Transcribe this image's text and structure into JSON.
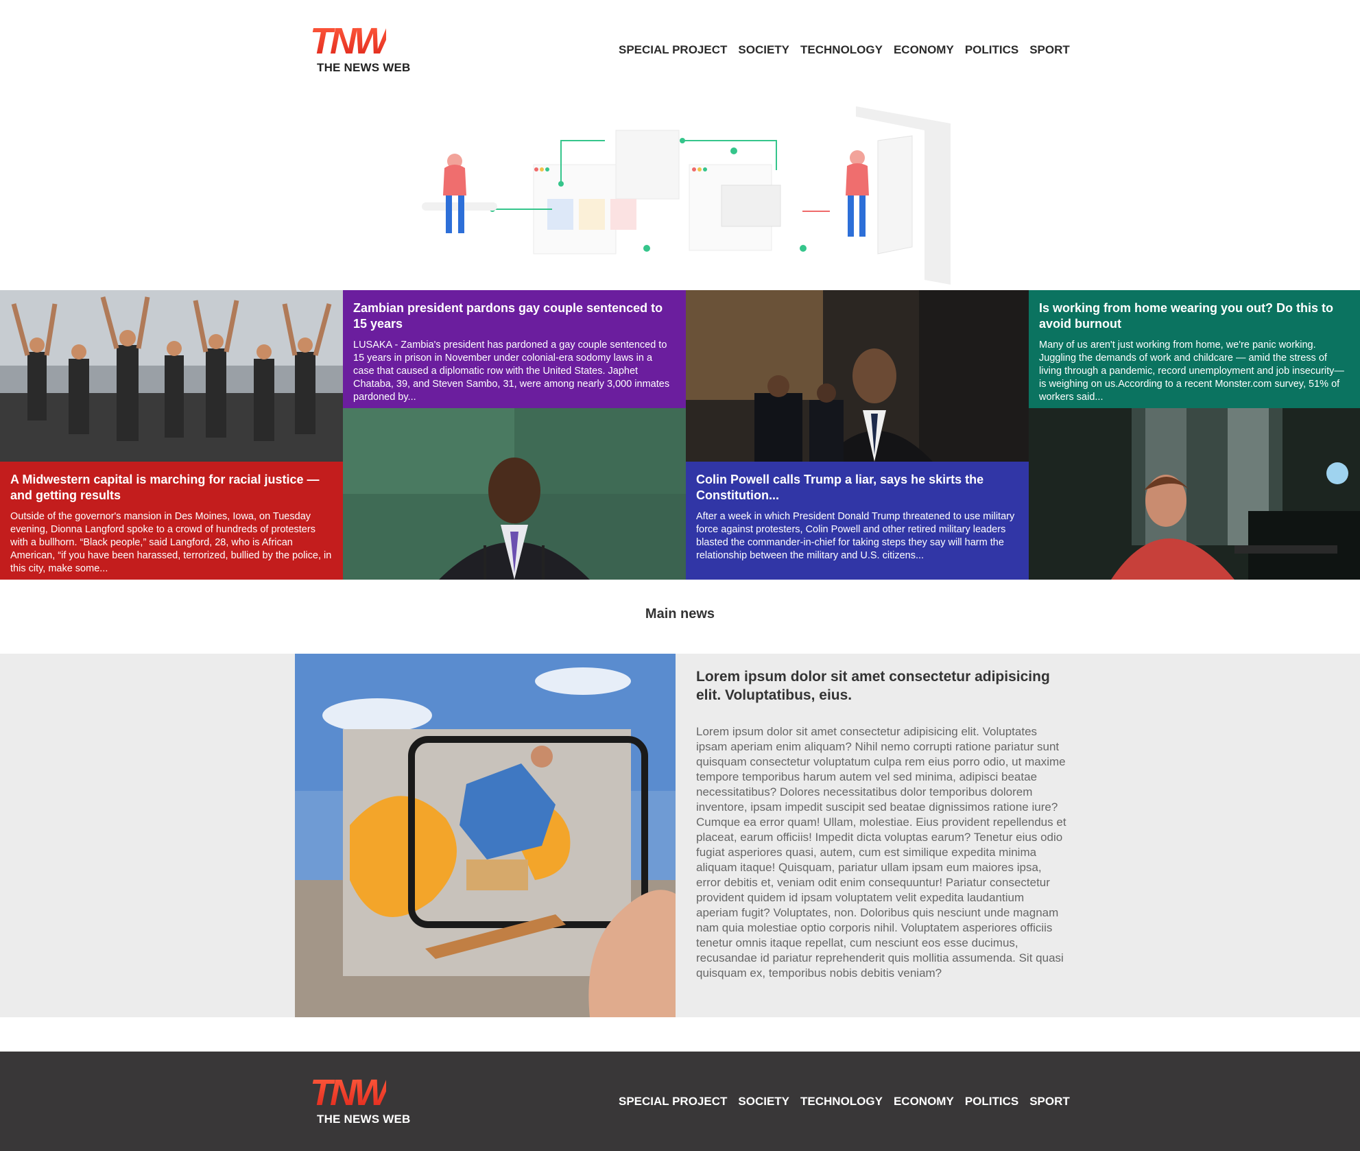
{
  "header": {
    "logo_mark": "TNW",
    "logo_sub": "THE NEWS WEB",
    "nav": [
      "SPECIAL PROJECT",
      "SOCIETY",
      "TECHNOLOGY",
      "ECONOMY",
      "POLITICS",
      "SPORT"
    ]
  },
  "articles": [
    {
      "title": "A Midwestern capital is marching for racial justice — and getting results",
      "excerpt": "Outside of the governor's mansion in Des Moines, Iowa, on Tuesday evening, Dionna Langford spoke to a crowd of hundreds of protesters with a bullhorn. “Black people,” said Langford, 28, who is African American, “if you have been harassed, terrorized, bullied by the police, in this city, make some...",
      "color": "#c31d1d"
    },
    {
      "title": "Zambian president pardons gay couple sentenced to 15 years",
      "excerpt": "LUSAKA - Zambia's president has pardoned a gay couple sentenced to 15 years in prison in November under colonial-era sodomy laws in a case that caused a diplomatic row with the United States. Japhet Chataba, 39, and Steven Sambo, 31, were among nearly 3,000 inmates pardoned by...",
      "color": "#6b1e9e"
    },
    {
      "title": "Colin Powell calls Trump a liar, says he skirts the Constitution...",
      "excerpt": "After a week in which President Donald Trump threatened to use military force against protesters, Colin Powell and other retired military leaders blasted the commander-in-chief for taking steps they say will harm the relationship between the military and U.S. citizens...",
      "color": "#3136a6"
    },
    {
      "title": "Is working from home wearing you out? Do this to avoid burnout",
      "excerpt": "Many of us aren't just working from home, we're panic working. Juggling the demands of work and childcare — amid the stress of living through a pandemic, record unemployment and job insecurity— is weighing on us.According to a recent Monster.com survey, 51% of workers said...",
      "color": "#0b7360"
    }
  ],
  "main": {
    "section_title": "Main news",
    "title": "Lorem ipsum dolor sit amet consectetur adipisicing elit. Voluptatibus, eius.",
    "body": "Lorem ipsum dolor sit amet consectetur adipisicing elit. Voluptates ipsam aperiam enim aliquam? Nihil nemo corrupti ratione pariatur sunt quisquam consectetur voluptatum culpa rem eius porro odio, ut maxime tempore temporibus harum autem vel sed minima, adipisci beatae necessitatibus? Dolores necessitatibus dolor temporibus dolorem inventore, ipsam impedit suscipit sed beatae dignissimos ratione iure? Cumque ea error quam! Ullam, molestiae. Eius provident repellendus et placeat, earum officiis! Impedit dicta voluptas earum? Tenetur eius odio fugiat asperiores quasi, autem, cum est similique expedita minima aliquam itaque! Quisquam, pariatur ullam ipsam eum maiores ipsa, error debitis et, veniam odit enim consequuntur! Pariatur consectetur provident quidem id ipsam voluptatem velit expedita laudantium aperiam fugit? Voluptates, non. Doloribus quis nesciunt unde magnam nam quia molestiae optio corporis nihil. Voluptatem asperiores officiis tenetur omnis itaque repellat, cum nesciunt eos esse ducimus, recusandae id pariatur reprehenderit quis mollitia assumenda. Sit quasi quisquam ex, temporibus nobis debitis veniam?"
  },
  "footer": {
    "logo_mark": "TNW",
    "logo_sub": "THE NEWS WEB",
    "nav": [
      "SPECIAL PROJECT",
      "SOCIETY",
      "TECHNOLOGY",
      "ECONOMY",
      "POLITICS",
      "SPORT"
    ]
  },
  "theme": {
    "brand_red": "#e0291d",
    "footer_bg": "#393738",
    "feature_bg": "#ececec"
  }
}
